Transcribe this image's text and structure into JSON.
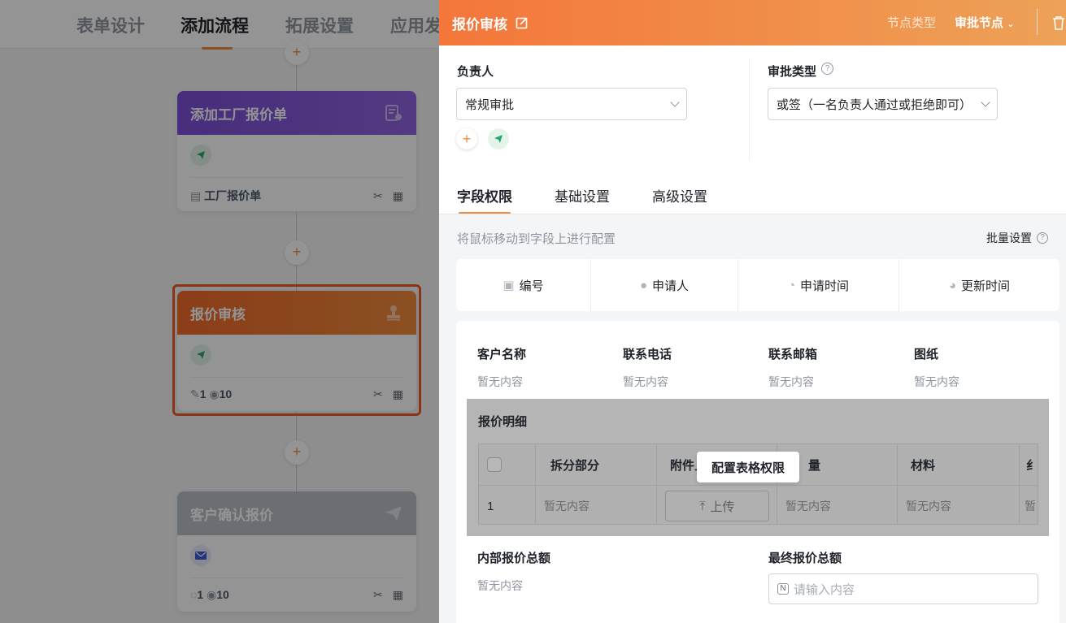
{
  "nav": {
    "tabs": [
      "表单设计",
      "添加流程",
      "拓展设置",
      "应用发"
    ]
  },
  "flow": {
    "plus": "+",
    "nodes": [
      {
        "title": "添加工厂报价单",
        "color": "#7c4fd9",
        "footer_text": "工厂报价单",
        "footer_icons": [
          "cut-icon",
          "copy-icon"
        ]
      },
      {
        "title": "报价审核",
        "color": "#f07a2e",
        "edit_count": "1",
        "view_count": "10"
      },
      {
        "title": "客户确认报价",
        "color": "#b8bdc6",
        "edit_count": "1",
        "view_count": "10"
      }
    ]
  },
  "panel": {
    "title": "报价审核",
    "node_type_label": "节点类型",
    "node_type_value": "审批节点",
    "owner_label": "负责人",
    "owner_value": "常规审批",
    "approval_type_label": "审批类型",
    "approval_type_value": "或签（一名负责人通过或拒绝即可）",
    "add_symbol": "+",
    "tabs": [
      "字段权限",
      "基础设置",
      "高级设置"
    ],
    "hint": "将鼠标移动到字段上进行配置",
    "batch_label": "批量设置",
    "system_fields": [
      "编号",
      "申请人",
      "申请时间",
      "更新时间"
    ],
    "fields": [
      {
        "label": "客户名称",
        "value": "暂无内容"
      },
      {
        "label": "联系电话",
        "value": "暂无内容"
      },
      {
        "label": "联系邮箱",
        "value": "暂无内容"
      },
      {
        "label": "图纸",
        "value": "暂无内容"
      }
    ],
    "subtable": {
      "title": "报价明细",
      "headers": [
        "拆分部分",
        "附件上",
        "量",
        "材料",
        "纟"
      ],
      "row": {
        "index": "1",
        "c1": "暂无内容",
        "upload_label": "上传",
        "c3": "暂无内容",
        "c4": "暂无内容",
        "c5": "暂"
      },
      "tooltip": "配置表格权限"
    },
    "internal_total_label": "内部报价总额",
    "internal_total_value": "暂无内容",
    "final_total_label": "最终报价总额",
    "final_total_placeholder": "请输入内容"
  },
  "colors": {
    "accent": "#f08a3c",
    "header_from": "#f4763a",
    "header_to": "#eda257",
    "selected_border": "#f05a24"
  }
}
